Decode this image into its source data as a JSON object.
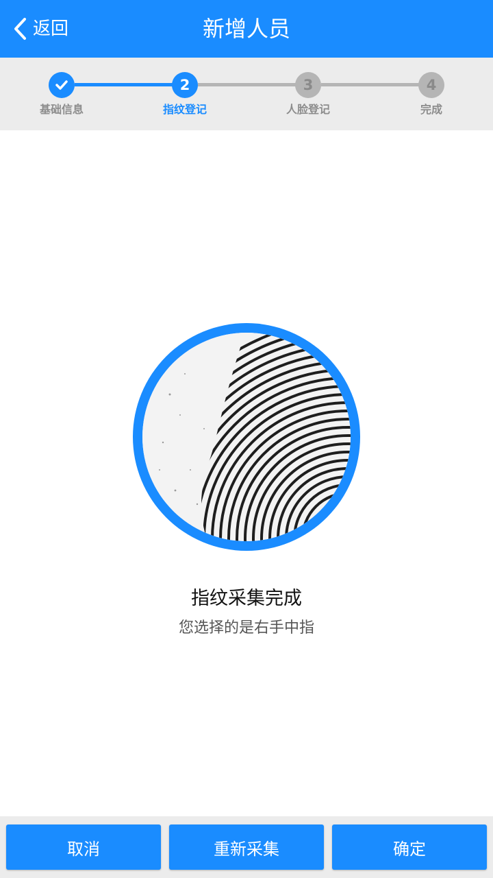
{
  "header": {
    "back_label": "返回",
    "title": "新增人员"
  },
  "stepper": {
    "steps": [
      {
        "number": "",
        "label": "基础信息",
        "state": "done"
      },
      {
        "number": "2",
        "label": "指纹登记",
        "state": "active"
      },
      {
        "number": "3",
        "label": "人脸登记",
        "state": "pending"
      },
      {
        "number": "4",
        "label": "完成",
        "state": "pending"
      }
    ]
  },
  "main": {
    "status_title": "指纹采集完成",
    "status_subtitle": "您选择的是右手中指"
  },
  "footer": {
    "cancel_label": "取消",
    "recapture_label": "重新采集",
    "confirm_label": "确定"
  },
  "colors": {
    "accent": "#1a8cff",
    "inactive": "#b5b5b5",
    "step_bg": "#ececec"
  }
}
